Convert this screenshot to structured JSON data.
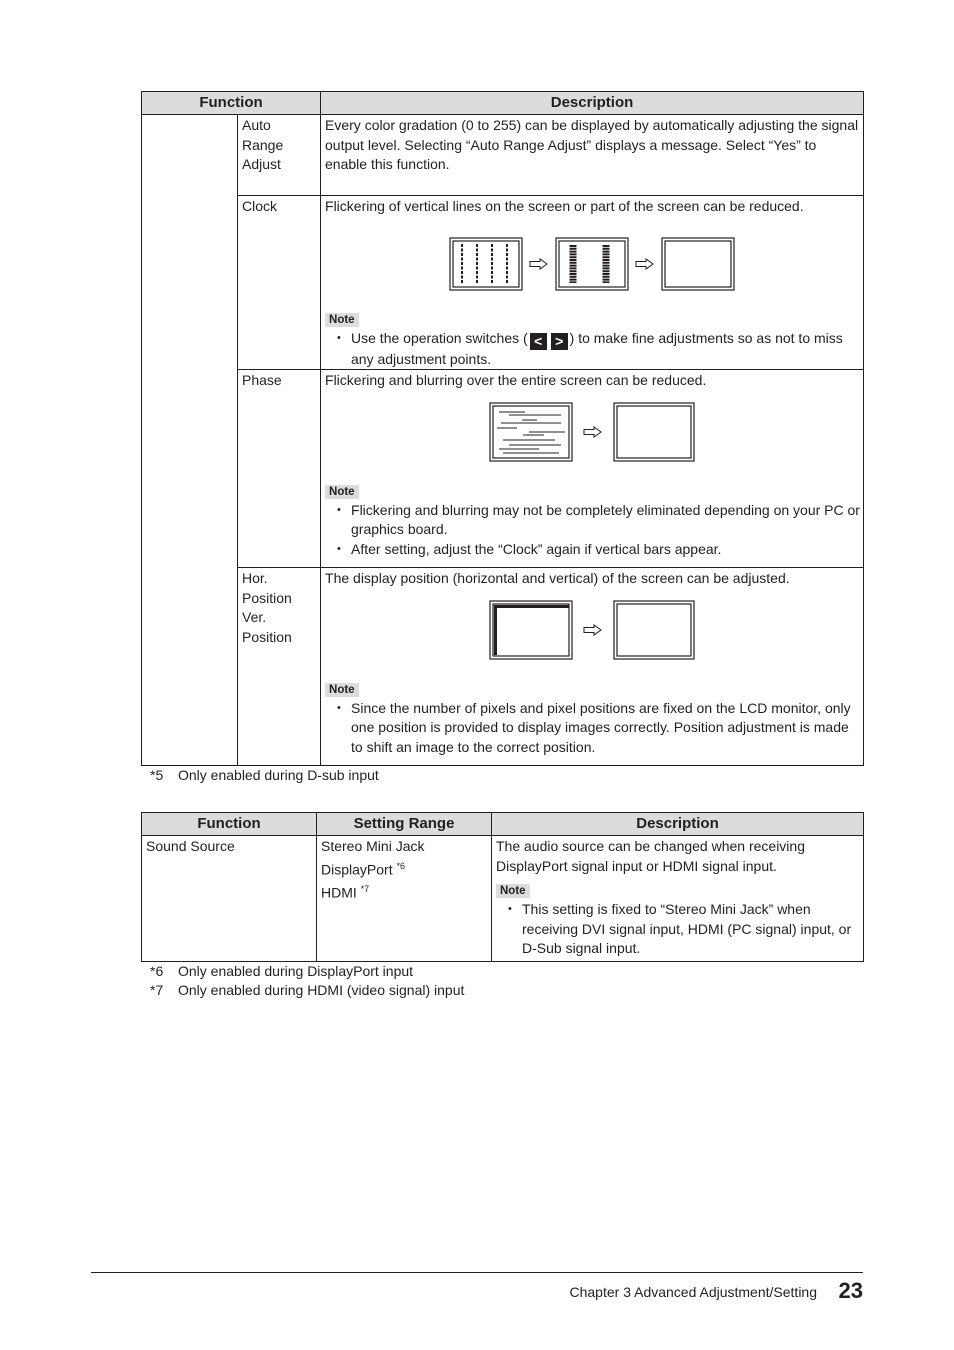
{
  "table1": {
    "headers": {
      "function": "Function",
      "description": "Description"
    },
    "rows": [
      {
        "function": [
          "Auto",
          "Range",
          "Adjust"
        ],
        "description": "Every color gradation (0 to 255) can be displayed by automatically adjusting the signal output level. Selecting “Auto Range Adjust” displays a message. Select “Yes” to enable this function."
      },
      {
        "function": [
          "Clock"
        ],
        "description": "Flickering of vertical lines on the screen or part of the screen can be reduced.",
        "illustration": "clock-adjustment-diagram",
        "note_label": "Note",
        "note_items": [
          {
            "before": "Use the operation switches (",
            "key_left": "<",
            "key_right": ">",
            "after": ") to make fine adjustments so as not to miss any adjustment points."
          }
        ]
      },
      {
        "function": [
          "Phase"
        ],
        "description": "Flickering and blurring over the entire screen can be reduced.",
        "illustration": "phase-adjustment-diagram",
        "note_label": "Note",
        "note_items": [
          "Flickering and blurring may not be completely eliminated depending on your PC or graphics board.",
          "After setting, adjust the “Clock” again if vertical bars appear."
        ]
      },
      {
        "function": [
          "Hor.",
          "Position",
          "Ver.",
          "Position"
        ],
        "description": "The display position (horizontal and vertical) of the screen can be adjusted.",
        "illustration": "position-adjustment-diagram",
        "note_label": "Note",
        "note_items": [
          "Since the number of pixels and pixel positions are fixed on the LCD monitor, only one position is provided to display images correctly. Position adjustment is made to shift an image to the correct position."
        ]
      }
    ],
    "footnote": {
      "mark": "*5",
      "text": "Only enabled during D-sub input"
    }
  },
  "table2": {
    "headers": {
      "function": "Function",
      "setting_range": "Setting Range",
      "description": "Description"
    },
    "row": {
      "function": "Sound Source",
      "settings": [
        {
          "label": "Stereo Mini Jack",
          "sup": ""
        },
        {
          "label": "DisplayPort ",
          "sup": "*6"
        },
        {
          "label": "HDMI ",
          "sup": "*7"
        }
      ],
      "description": "The audio source can be changed when receiving DisplayPort signal input or HDMI signal input.",
      "note_label": "Note",
      "note_items": [
        "This setting is fixed to “Stereo Mini Jack” when receiving DVI signal input, HDMI (PC signal) input, or D-Sub signal input."
      ]
    },
    "footnotes": [
      {
        "mark": "*6",
        "text": "Only enabled during DisplayPort input"
      },
      {
        "mark": "*7",
        "text": "Only enabled during HDMI (video signal) input"
      }
    ]
  },
  "footer": {
    "chapter": "Chapter 3 Advanced Adjustment/Setting",
    "page": "23"
  }
}
